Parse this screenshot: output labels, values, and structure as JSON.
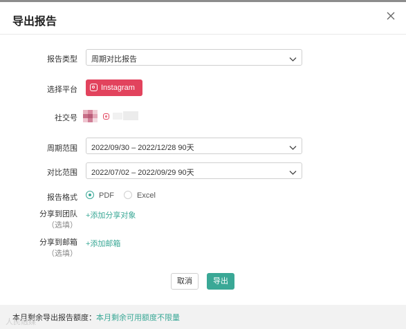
{
  "dialog": {
    "title": "导出报告"
  },
  "form": {
    "report_type": {
      "label": "报告类型",
      "value": "周期对比报告"
    },
    "platform": {
      "label": "选择平台",
      "button": "Instagram"
    },
    "social": {
      "label": "社交号"
    },
    "period": {
      "label": "周期范围",
      "value": "2022/09/30 – 2022/12/28 90天"
    },
    "compare": {
      "label": "对比范围",
      "value": "2022/07/02 – 2022/09/29 90天"
    },
    "format": {
      "label": "报告格式",
      "options": [
        "PDF",
        "Excel"
      ],
      "selected": "PDF"
    },
    "share_team": {
      "label": "分享到团队",
      "sub": "（选填）",
      "link": "+添加分享对象"
    },
    "share_email": {
      "label": "分享到邮箱",
      "sub": "（选填）",
      "link": "+添加邮箱"
    }
  },
  "buttons": {
    "cancel": "取消",
    "export": "导出"
  },
  "footer": {
    "label": "本月剩余导出报告额度：",
    "value": "本月剩余可用额度不限量"
  },
  "watermark": "人民融媒",
  "colors": {
    "accent": "#3aa896",
    "instagram": "#e2435d"
  },
  "icons": [
    "close-icon",
    "chevron-down-icon",
    "instagram-icon"
  ]
}
